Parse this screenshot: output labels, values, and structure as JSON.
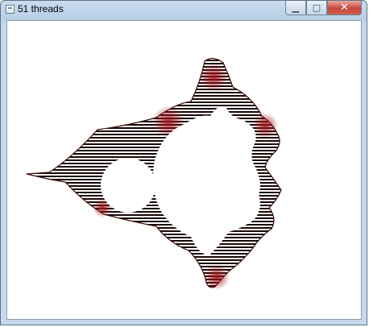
{
  "window": {
    "title": "51 threads",
    "icon": "app-window-icon",
    "controls": {
      "minimize_icon": "minimize-icon",
      "maximize_icon": "maximize-icon",
      "close_icon": "close-icon"
    }
  },
  "canvas": {
    "content": "mandelbrot-fractal-render",
    "colors": {
      "stripe": "#1a0606",
      "glow": "#a3121a",
      "background": "#ffffff"
    }
  }
}
